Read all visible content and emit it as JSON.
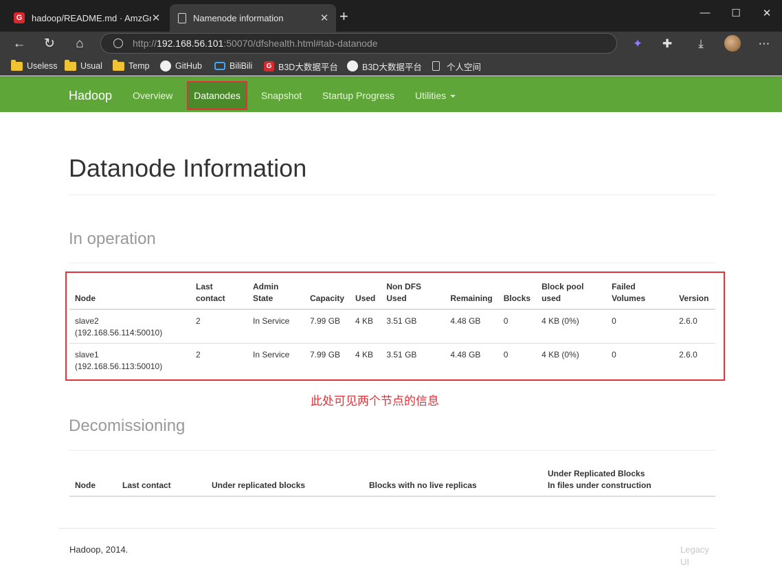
{
  "browser": {
    "tabs": [
      {
        "title": "hadoop/README.md · AmzGrain",
        "favicon": "G",
        "active": false
      },
      {
        "title": "Namenode information",
        "favicon": "doc",
        "active": true
      }
    ],
    "url": {
      "scheme": "http://",
      "host": "192.168.56.101",
      "rest": ":50070/dfshealth.html#tab-datanode"
    },
    "bookmarks": [
      {
        "label": "Useless",
        "icon": "folder-icon"
      },
      {
        "label": "Usual",
        "icon": "folder-icon"
      },
      {
        "label": "Temp",
        "icon": "folder-icon"
      },
      {
        "label": "GitHub",
        "icon": "github-icon"
      },
      {
        "label": "BiliBili",
        "icon": "bilibili-icon"
      },
      {
        "label": "B3D大数据平台",
        "icon": "g-icon"
      },
      {
        "label": "B3D大数据平台",
        "icon": "github-icon"
      },
      {
        "label": "个人空间",
        "icon": "page-icon"
      }
    ]
  },
  "hadoop_nav": {
    "brand": "Hadoop",
    "items": [
      "Overview",
      "Datanodes",
      "Snapshot",
      "Startup Progress",
      "Utilities"
    ],
    "active_item": "Datanodes",
    "bg_color": "#5ea637"
  },
  "page": {
    "title": "Datanode Information",
    "in_operation": {
      "heading": "In operation",
      "columns": [
        [
          "",
          "Node"
        ],
        [
          "Last",
          "contact"
        ],
        [
          "Admin",
          "State"
        ],
        [
          "",
          "Capacity"
        ],
        [
          "",
          "Used"
        ],
        [
          "Non DFS",
          "Used"
        ],
        [
          "",
          "Remaining"
        ],
        [
          "",
          "Blocks"
        ],
        [
          "Block pool",
          "used"
        ],
        [
          "Failed",
          "Volumes"
        ],
        [
          "",
          "Version"
        ]
      ],
      "rows": [
        {
          "node": "slave2",
          "address": "(192.168.56.114:50010)",
          "last_contact": "2",
          "admin_state": "In Service",
          "capacity": "7.99 GB",
          "used": "4 KB",
          "non_dfs_used": "3.51 GB",
          "remaining": "4.48 GB",
          "blocks": "0",
          "block_pool_used": "4 KB (0%)",
          "failed_volumes": "0",
          "version": "2.6.0"
        },
        {
          "node": "slave1",
          "address": "(192.168.56.113:50010)",
          "last_contact": "2",
          "admin_state": "In Service",
          "capacity": "7.99 GB",
          "used": "4 KB",
          "non_dfs_used": "3.51 GB",
          "remaining": "4.48 GB",
          "blocks": "0",
          "block_pool_used": "4 KB (0%)",
          "failed_volumes": "0",
          "version": "2.6.0"
        }
      ]
    },
    "annotation": "此处可见两个节点的信息",
    "decommissioning": {
      "heading": "Decomissioning",
      "columns": [
        [
          "",
          "Node"
        ],
        [
          "",
          "Last contact"
        ],
        [
          "",
          "Under replicated blocks"
        ],
        [
          "",
          "Blocks with no live replicas"
        ],
        [
          "Under Replicated Blocks",
          "In files under construction"
        ]
      ]
    },
    "footer": {
      "text": "Hadoop, 2014.",
      "legacy_link": "Legacy UI"
    }
  },
  "colors": {
    "highlight": "#e0323a",
    "nav_green": "#5ea637"
  }
}
